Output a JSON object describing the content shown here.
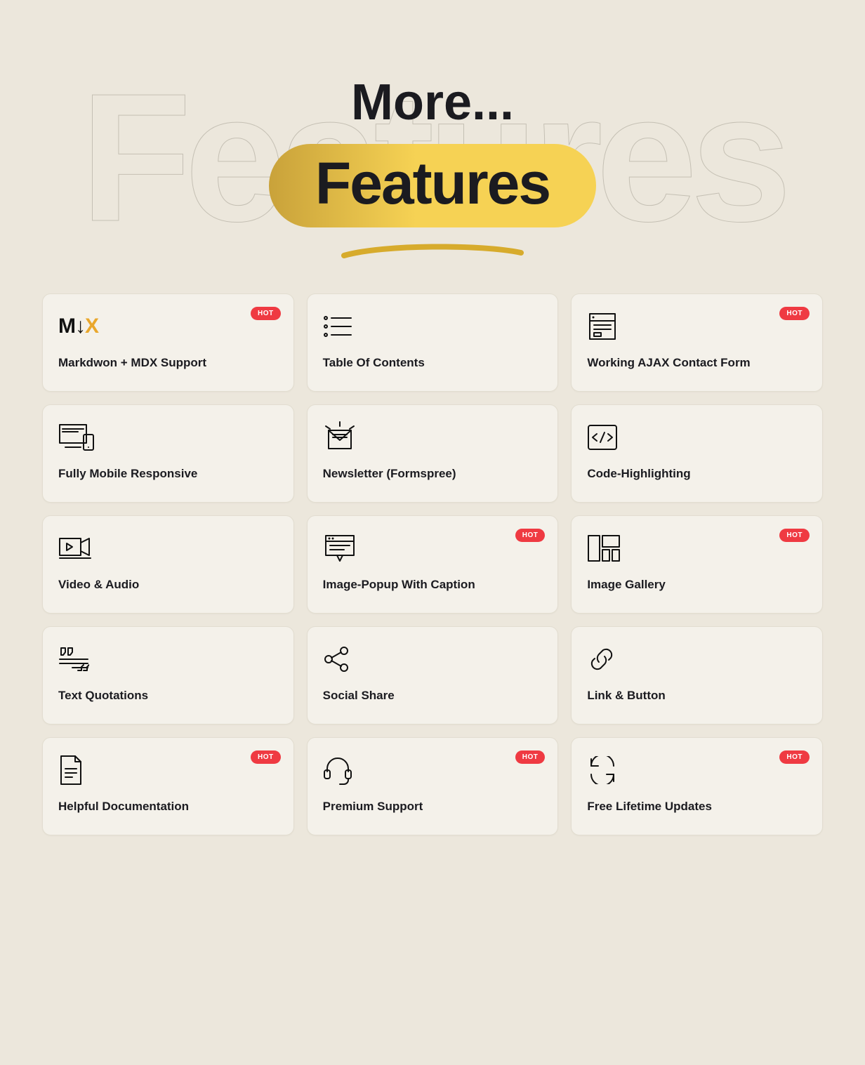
{
  "hero": {
    "more": "More...",
    "features": "Features",
    "bg_word": "Features"
  },
  "badge_label": "HOT",
  "cards": [
    {
      "icon": "mdx",
      "title": "Markdwon + MDX Support",
      "hot": true
    },
    {
      "icon": "toc",
      "title": "Table Of Contents",
      "hot": false
    },
    {
      "icon": "form",
      "title": "Working AJAX Contact Form",
      "hot": true
    },
    {
      "icon": "responsive",
      "title": "Fully Mobile Responsive",
      "hot": false
    },
    {
      "icon": "newsletter",
      "title": "Newsletter (Formspree)",
      "hot": false
    },
    {
      "icon": "code",
      "title": "Code-Highlighting",
      "hot": false
    },
    {
      "icon": "video",
      "title": "Video & Audio",
      "hot": false
    },
    {
      "icon": "popup",
      "title": "Image-Popup With Caption",
      "hot": true
    },
    {
      "icon": "gallery",
      "title": "Image Gallery",
      "hot": true
    },
    {
      "icon": "quote",
      "title": "Text Quotations",
      "hot": false
    },
    {
      "icon": "share",
      "title": "Social Share",
      "hot": false
    },
    {
      "icon": "link",
      "title": "Link & Button",
      "hot": false
    },
    {
      "icon": "doc",
      "title": "Helpful Documentation",
      "hot": true
    },
    {
      "icon": "support",
      "title": "Premium Support",
      "hot": true
    },
    {
      "icon": "updates",
      "title": "Free Lifetime Updates",
      "hot": true
    }
  ]
}
